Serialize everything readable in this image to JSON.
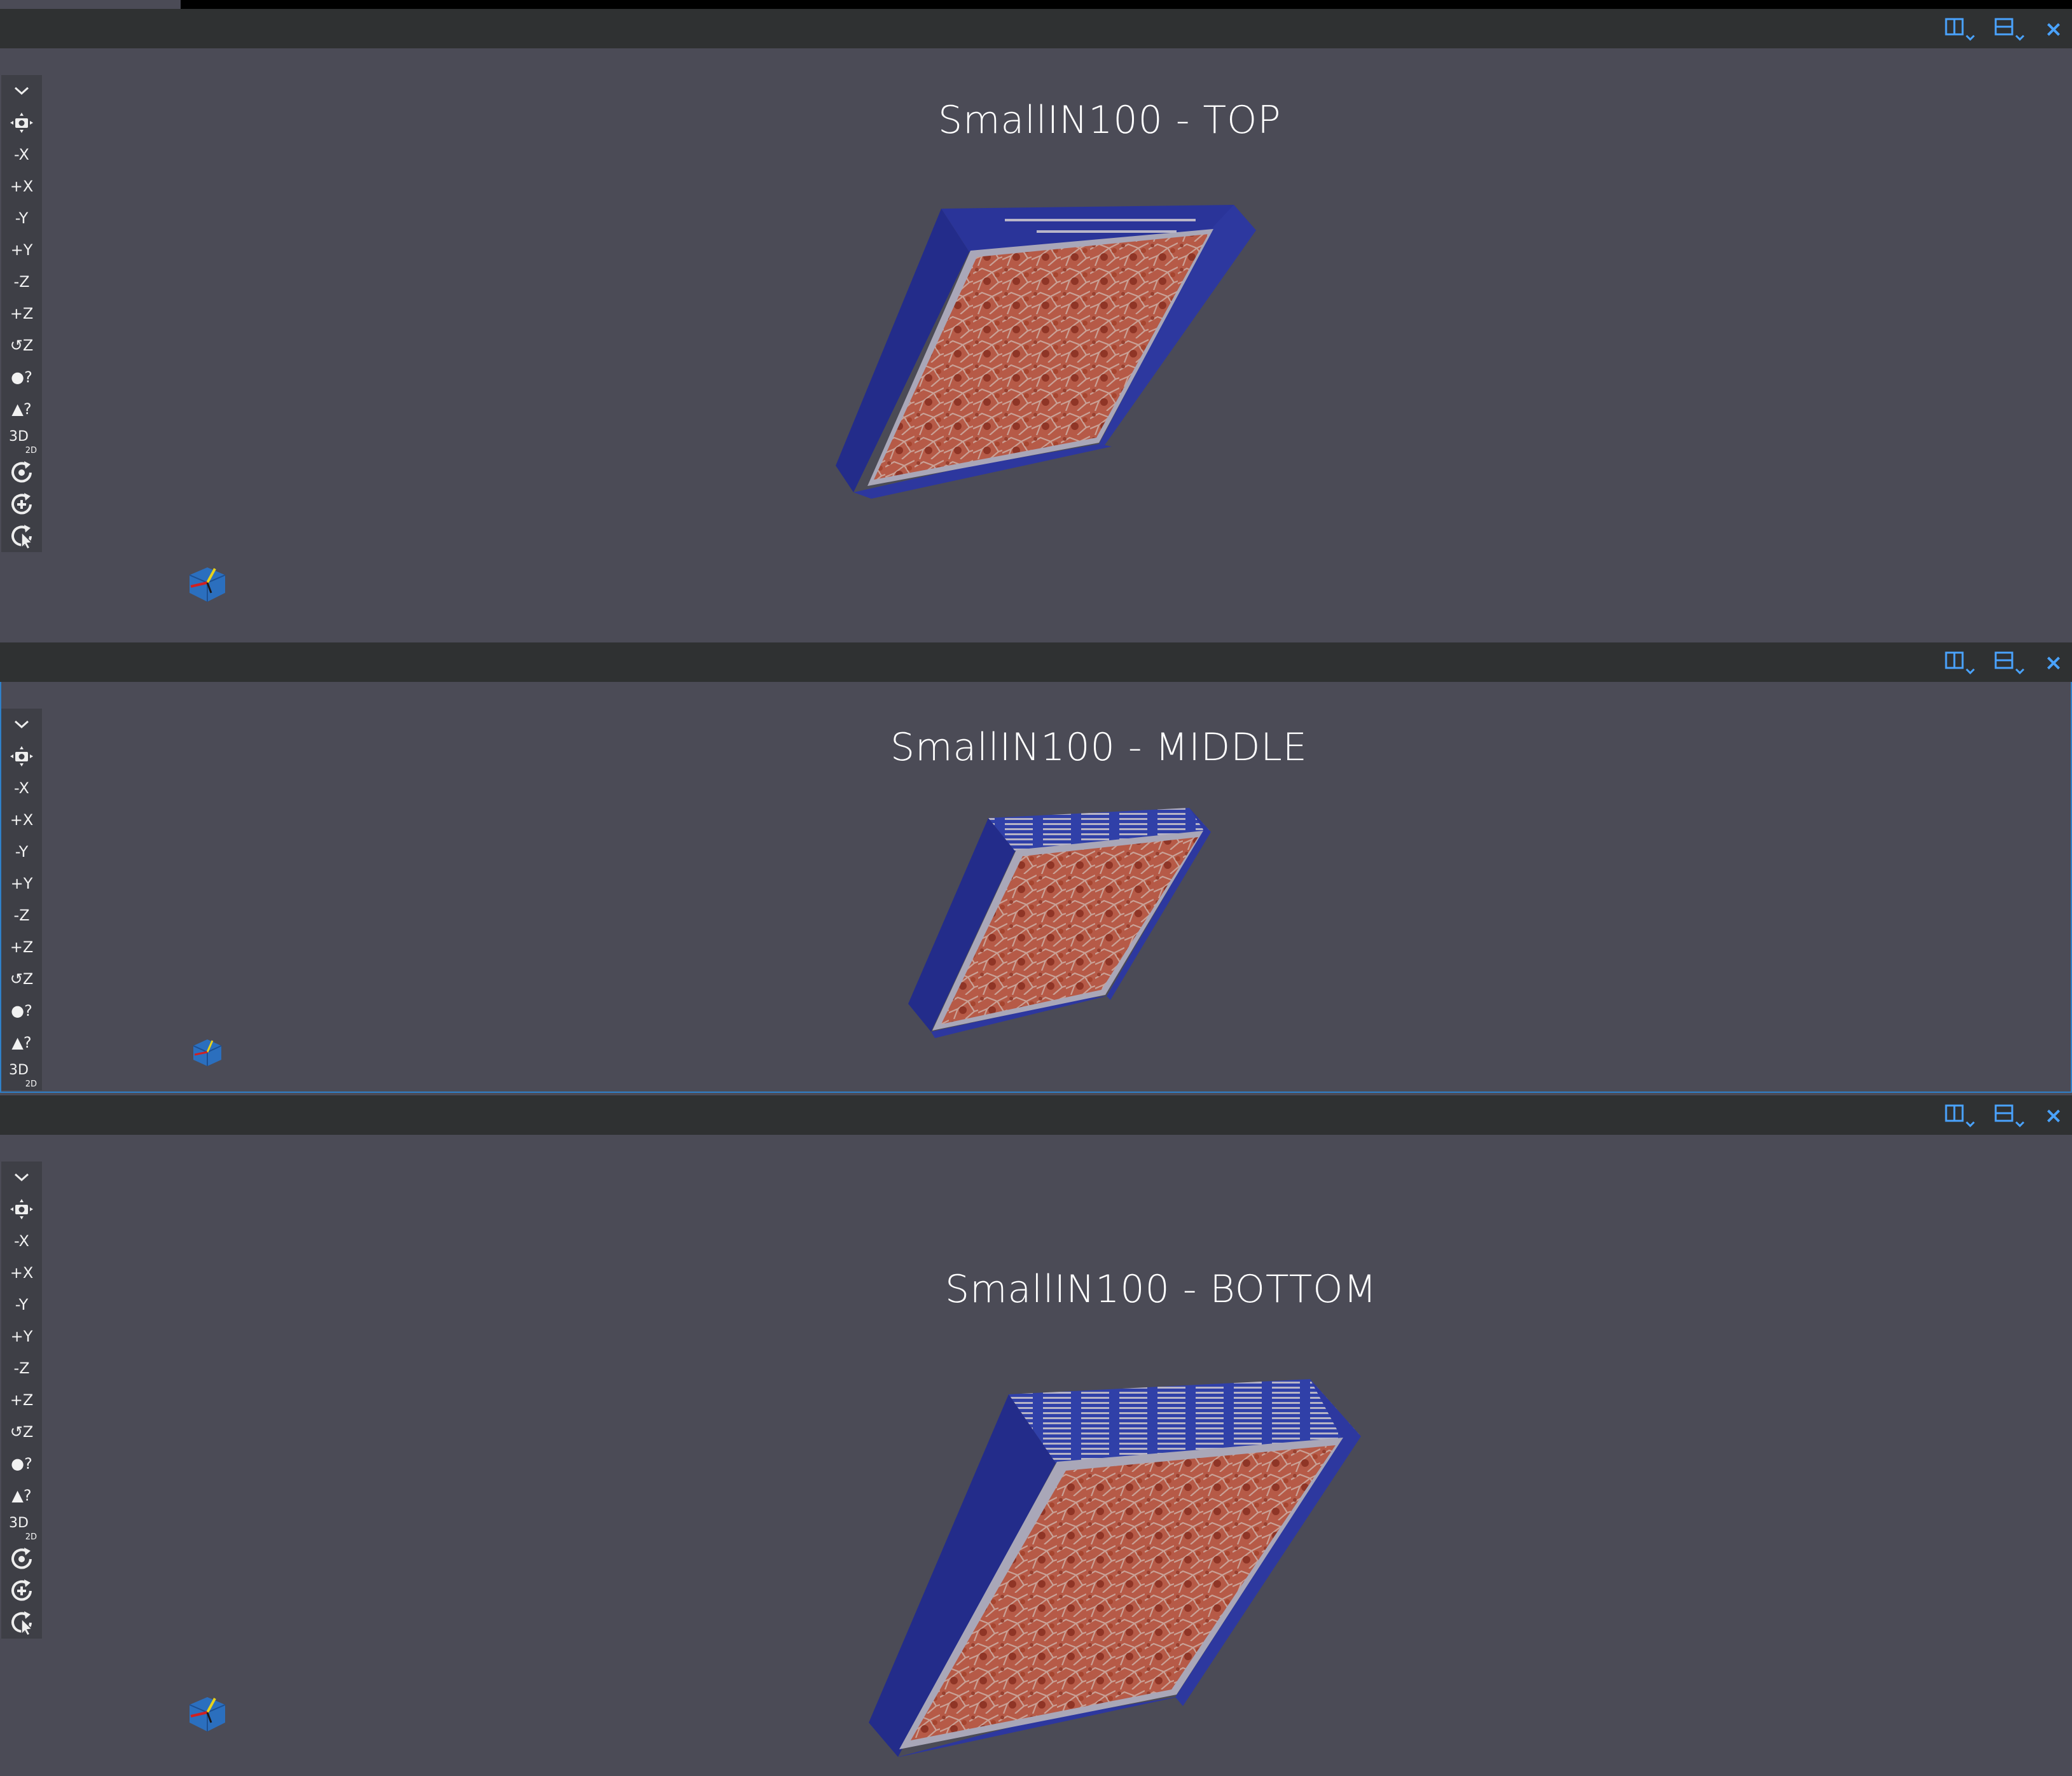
{
  "header_buttons": {
    "split_horizontal_icon": "split-horizontal-icon",
    "split_vertical_icon": "split-vertical-icon",
    "close_symbol": "×"
  },
  "toolbar": {
    "reset_camera_icon": "camera-reset-icon",
    "minus_x": "-X",
    "plus_x": "+X",
    "minus_y": "-Y",
    "plus_y": "+Y",
    "minus_z": "-Z",
    "plus_z": "+Z",
    "rotate_90": "↺Z",
    "pick_center": "●?",
    "pick_triangle": "▲?",
    "mode_3d": "3D",
    "mode_2d": "2D"
  },
  "panes": [
    {
      "title": "SmallIN100 - TOP"
    },
    {
      "title": "SmallIN100 - MIDDLE"
    },
    {
      "title": "SmallIN100 - BOTTOM"
    }
  ],
  "colors": {
    "background": "#4b4b56",
    "header": "#2f3132",
    "active_border": "#2f80c8",
    "slab_blue": "#2a3499",
    "grain_red": "#b0503d"
  }
}
